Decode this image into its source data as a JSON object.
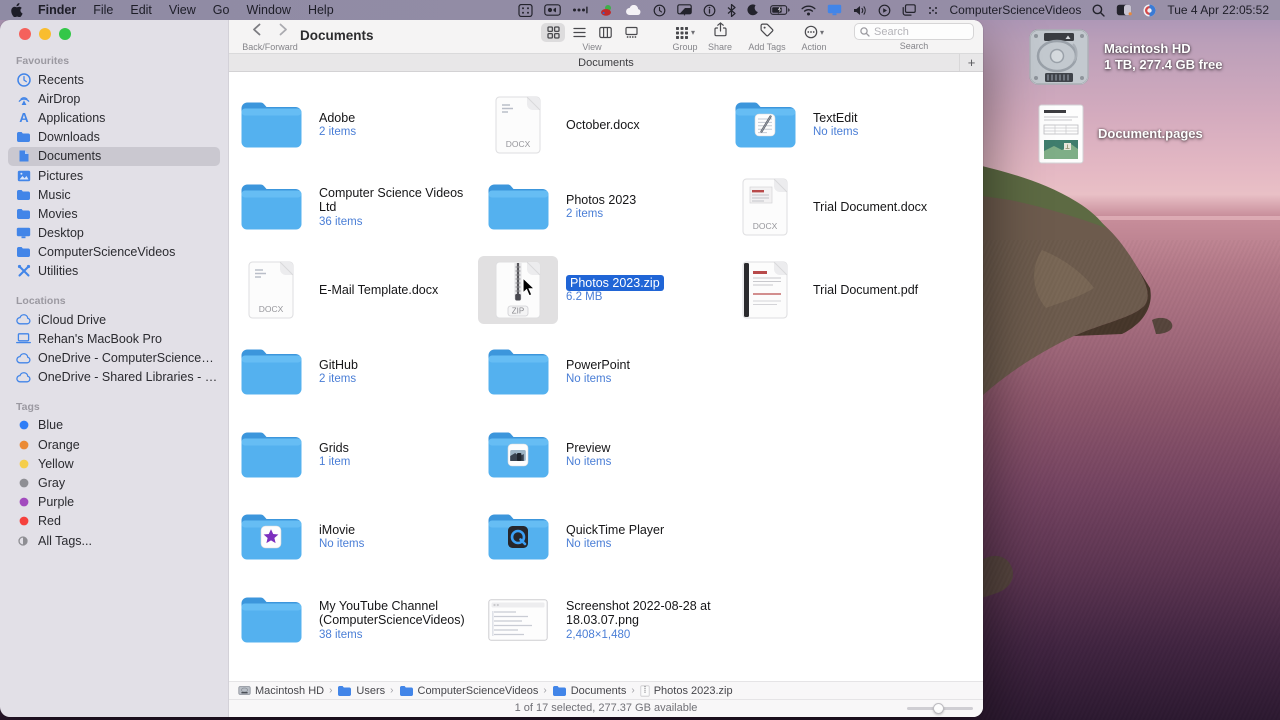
{
  "menu_bar": {
    "menus": [
      "Finder",
      "File",
      "Edit",
      "View",
      "Go",
      "Window",
      "Help"
    ],
    "status_icons": [
      "app-grid",
      "screen-rec",
      "ellipsis-bar",
      "app-color",
      "cloud",
      "timer",
      "display-mirror",
      "info",
      "bluetooth",
      "moon",
      "battery",
      "wifi",
      "monitor",
      "speaker",
      "play-circle",
      "windows-stack",
      "dots4"
    ],
    "account_name": "ComputerScienceVideos",
    "right_icons": [
      "magnifier",
      "user-switch",
      "control-center"
    ],
    "clock": "Tue 4 Apr 22:05:52"
  },
  "window": {
    "title": "Documents",
    "toolbar": {
      "back_forward_label": "Back/Forward",
      "view_label": "View",
      "group_label": "Group",
      "share_label": "Share",
      "add_tags_label": "Add Tags",
      "action_label": "Action",
      "search_label": "Search",
      "search_placeholder": "Search"
    },
    "tab": {
      "label": "Documents",
      "new_tab_label": "+"
    }
  },
  "sidebar": {
    "sections": [
      {
        "title": "Favourites",
        "items": [
          {
            "label": "Recents",
            "icon": "clock"
          },
          {
            "label": "AirDrop",
            "icon": "airdrop"
          },
          {
            "label": "Applications",
            "icon": "letter-a"
          },
          {
            "label": "Downloads",
            "icon": "folder"
          },
          {
            "label": "Documents",
            "icon": "doc",
            "selected": true
          },
          {
            "label": "Pictures",
            "icon": "photo"
          },
          {
            "label": "Music",
            "icon": "folder"
          },
          {
            "label": "Movies",
            "icon": "folder"
          },
          {
            "label": "Desktop",
            "icon": "monitor"
          },
          {
            "label": "ComputerScienceVideos",
            "icon": "folder"
          },
          {
            "label": "Utilities",
            "icon": "utils"
          }
        ]
      },
      {
        "title": "Locations",
        "items": [
          {
            "label": "iCloud Drive",
            "icon": "cloud-o"
          },
          {
            "label": "Rehan's MacBook Pro",
            "icon": "laptop"
          },
          {
            "label": "OneDrive - ComputerScienceVideos",
            "icon": "cloud-o"
          },
          {
            "label": "OneDrive - Shared Libraries - Comp...",
            "icon": "cloud-o"
          }
        ]
      },
      {
        "title": "Tags",
        "items": [
          {
            "label": "Blue",
            "icon": "tag",
            "color": "#2e7df6"
          },
          {
            "label": "Orange",
            "icon": "tag",
            "color": "#ea8a35"
          },
          {
            "label": "Yellow",
            "icon": "tag",
            "color": "#f5ce4b"
          },
          {
            "label": "Gray",
            "icon": "tag",
            "color": "#8e8e93"
          },
          {
            "label": "Purple",
            "icon": "tag",
            "color": "#a24bbe"
          },
          {
            "label": "Red",
            "icon": "tag",
            "color": "#f5413d"
          },
          {
            "label": "All Tags...",
            "icon": "all-tags"
          }
        ]
      }
    ]
  },
  "files": [
    {
      "name": "Adobe",
      "info": "2 items",
      "type": "folder",
      "col": 0,
      "row": 0
    },
    {
      "name": "October.docx",
      "info": "",
      "type": "docx",
      "badge": "DOCX",
      "col": 1,
      "row": 0
    },
    {
      "name": "TextEdit",
      "info": "No items",
      "type": "folder-textedit",
      "col": 2,
      "row": 0
    },
    {
      "name": "Computer Science Videos Ltd",
      "info": "36 items",
      "type": "folder",
      "col": 0,
      "row": 1
    },
    {
      "name": "Photos 2023",
      "info": "2 items",
      "type": "folder",
      "col": 1,
      "row": 1
    },
    {
      "name": "Trial Document.docx",
      "info": "",
      "type": "docx-preview",
      "badge": "DOCX",
      "col": 2,
      "row": 1
    },
    {
      "name": "E-Mail Template.docx",
      "info": "",
      "type": "docx",
      "badge": "DOCX",
      "col": 0,
      "row": 2
    },
    {
      "name": "Photos 2023.zip",
      "info": "6.2 MB",
      "type": "zip",
      "badge": "ZIP",
      "selected": true,
      "col": 1,
      "row": 2
    },
    {
      "name": "Trial Document.pdf",
      "info": "",
      "type": "pdf",
      "col": 2,
      "row": 2
    },
    {
      "name": "GitHub",
      "info": "2 items",
      "type": "folder",
      "col": 0,
      "row": 3
    },
    {
      "name": "PowerPoint",
      "info": "No items",
      "type": "folder",
      "col": 1,
      "row": 3
    },
    {
      "name": "Grids",
      "info": "1 item",
      "type": "folder",
      "col": 0,
      "row": 4
    },
    {
      "name": "Preview",
      "info": "No items",
      "type": "folder-preview",
      "col": 1,
      "row": 4
    },
    {
      "name": "iMovie",
      "info": "No items",
      "type": "folder-imovie",
      "col": 0,
      "row": 5
    },
    {
      "name": "QuickTime Player",
      "info": "No items",
      "type": "folder-quicktime",
      "col": 1,
      "row": 5
    },
    {
      "name": "My YouTube Channel (ComputerScienceVideos)",
      "info": "38 items",
      "type": "folder",
      "col": 0,
      "row": 6
    },
    {
      "name": "Screenshot 2022-08-28 at 18.03.07.png",
      "info": "2,408×1,480",
      "type": "png",
      "col": 1,
      "row": 6
    }
  ],
  "path_bar": [
    {
      "label": "Macintosh HD",
      "icon": "mini-drive"
    },
    {
      "label": "Users",
      "icon": "mini-folder"
    },
    {
      "label": "ComputerScienceVideos",
      "icon": "mini-folder"
    },
    {
      "label": "Documents",
      "icon": "mini-folder"
    },
    {
      "label": "Photos 2023.zip",
      "icon": "mini-zip"
    }
  ],
  "status_bar": {
    "text": "1 of 17 selected, 277.37 GB available"
  },
  "desktop": {
    "icons": [
      {
        "name": "Macintosh HD",
        "info": "1 TB, 277.4 GB free",
        "type": "drive"
      },
      {
        "name": "Document.pages",
        "info": "",
        "type": "pages"
      }
    ]
  }
}
